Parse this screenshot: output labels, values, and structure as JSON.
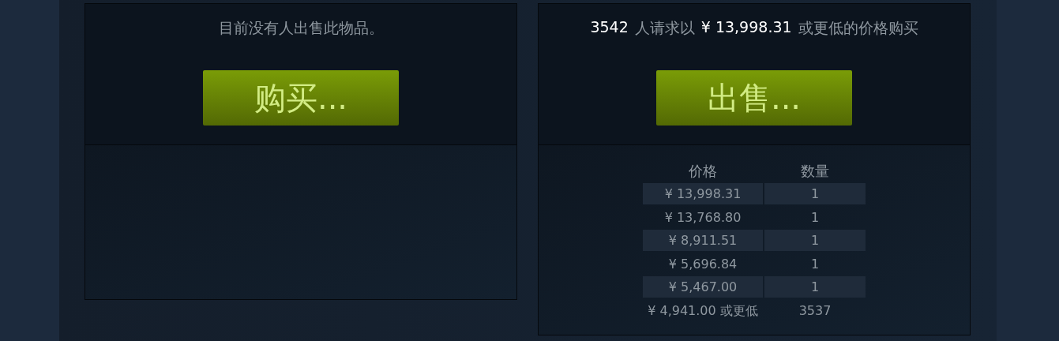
{
  "sell_panel": {
    "message": "目前没有人出售此物品。",
    "button": "购买..."
  },
  "buy_panel": {
    "header": {
      "count": "3542",
      "text_before": "人请求以",
      "price": "¥ 13,998.31",
      "text_after": "或更低的价格购买"
    },
    "button": "出售...",
    "table": {
      "columns": [
        "价格",
        "数量"
      ],
      "rows": [
        {
          "price": "¥ 13,998.31",
          "quantity": "1"
        },
        {
          "price": "¥ 13,768.80",
          "quantity": "1"
        },
        {
          "price": "¥ 8,911.51",
          "quantity": "1"
        },
        {
          "price": "¥ 5,696.84",
          "quantity": "1"
        },
        {
          "price": "¥ 5,467.00",
          "quantity": "1"
        },
        {
          "price": "¥ 4,941.00 或更低",
          "quantity": "3537"
        }
      ]
    }
  }
}
